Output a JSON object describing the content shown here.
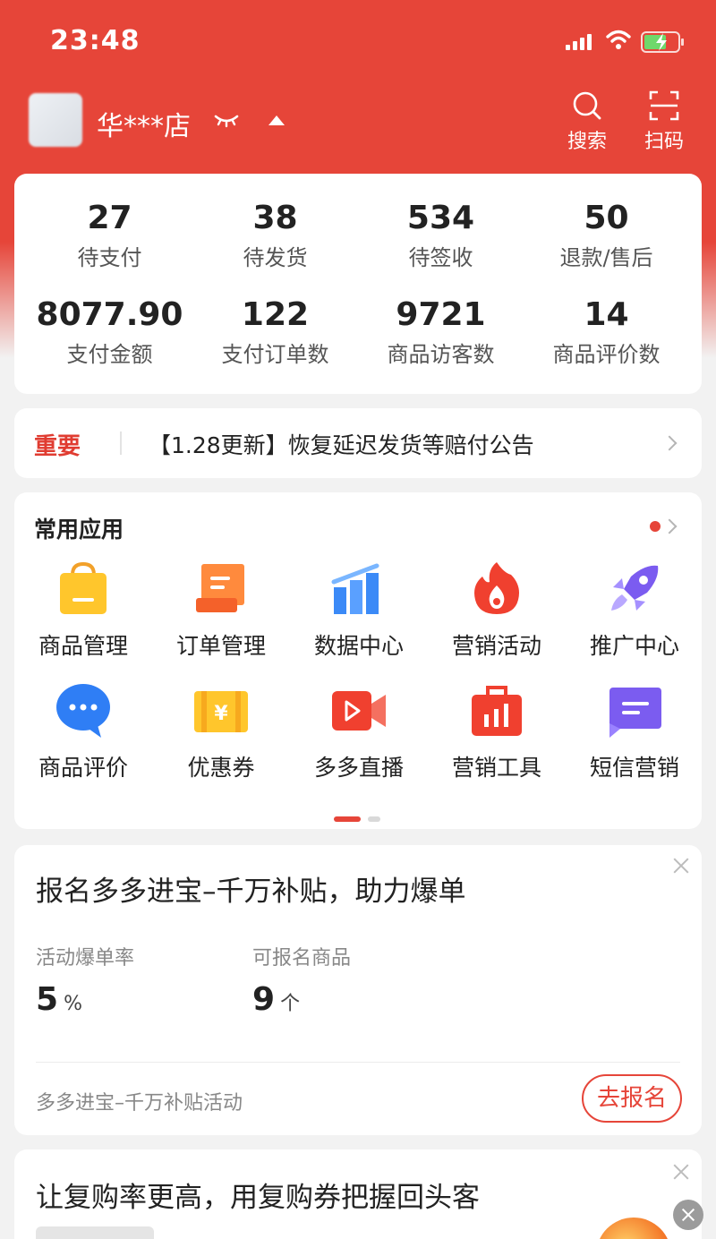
{
  "status_bar": {
    "time": "23:48"
  },
  "header": {
    "store_name": "华***店",
    "search_label": "搜索",
    "scan_label": "扫码"
  },
  "stats": [
    {
      "value": "27",
      "label": "待支付"
    },
    {
      "value": "38",
      "label": "待发货"
    },
    {
      "value": "534",
      "label": "待签收"
    },
    {
      "value": "50",
      "label": "退款/售后"
    },
    {
      "value": "8077.90",
      "label": "支付金额"
    },
    {
      "value": "122",
      "label": "支付订单数"
    },
    {
      "value": "9721",
      "label": "商品访客数"
    },
    {
      "value": "14",
      "label": "商品评价数"
    }
  ],
  "notice": {
    "tag": "重要",
    "text": "【1.28更新】恢复延迟发货等赔付公告"
  },
  "apps": {
    "title": "常用应用",
    "items": [
      {
        "label": "商品管理",
        "icon": "shopping-bag-icon"
      },
      {
        "label": "订单管理",
        "icon": "order-scroll-icon"
      },
      {
        "label": "数据中心",
        "icon": "bar-chart-icon"
      },
      {
        "label": "营销活动",
        "icon": "flame-icon"
      },
      {
        "label": "推广中心",
        "icon": "rocket-icon"
      },
      {
        "label": "商品评价",
        "icon": "chat-bubble-icon"
      },
      {
        "label": "优惠券",
        "icon": "coupon-icon"
      },
      {
        "label": "多多直播",
        "icon": "video-camera-icon"
      },
      {
        "label": "营销工具",
        "icon": "toolbox-icon"
      },
      {
        "label": "短信营销",
        "icon": "sms-icon"
      }
    ]
  },
  "promo": {
    "title": "报名多多进宝–千万补贴，助力爆单",
    "metric1_label": "活动爆单率",
    "metric1_value": "5",
    "metric1_unit": "%",
    "metric2_label": "可报名商品",
    "metric2_value": "9",
    "metric2_unit": "个",
    "footer": "多多进宝–千万补贴活动",
    "button": "去报名"
  },
  "repurchase": {
    "title": "让复购率更高，用复购券把握回头客"
  },
  "colors": {
    "brand_red": "#e64539",
    "accent_red": "#e03c31"
  }
}
